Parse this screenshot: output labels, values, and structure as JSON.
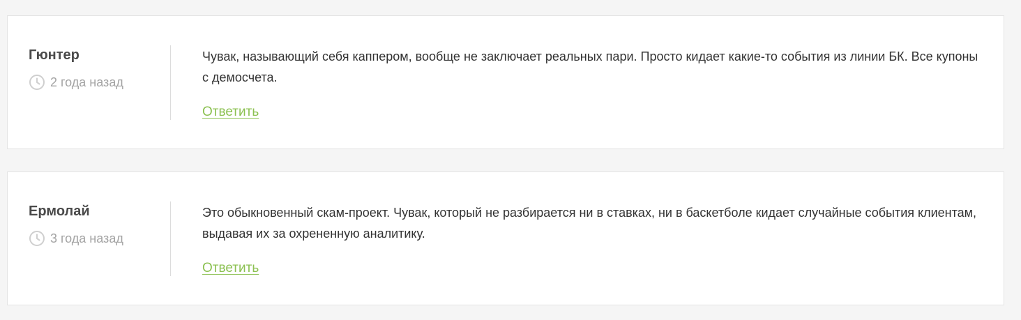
{
  "comments": [
    {
      "author": "Гюнтер",
      "time": "2 года назад",
      "icon": "clock-icon",
      "text": "Чувак, называющий себя каппером, вообще не заключает реальных пари. Просто кидает какие-то события из линии БК. Все купоны с демосчета.",
      "reply_label": "Ответить"
    },
    {
      "author": "Ермолай",
      "time": "3 года назад",
      "icon": "clock-icon",
      "text": "Это обыкновенный скам-проект. Чувак, который не разбирается ни в ставках, ни в баскетболе кидает случайные события клиентам, выдавая их за охрененную аналитику.",
      "reply_label": "Ответить"
    }
  ],
  "colors": {
    "background": "#f5f5f5",
    "card": "#ffffff",
    "author": "#4a4a4a",
    "time": "#a3a3a3",
    "text": "#333333",
    "link": "#8cc152"
  }
}
